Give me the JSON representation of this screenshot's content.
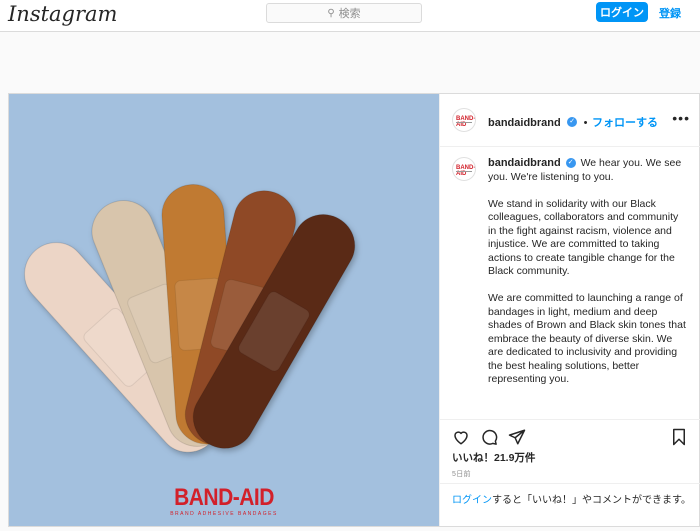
{
  "header": {
    "logo": "Instagram",
    "search_placeholder": "検索",
    "login_button": "ログイン",
    "signup_link": "登録"
  },
  "post": {
    "username": "bandaidbrand",
    "follow_label": "フォローする",
    "caption_lead": "We hear you. We see you. We're listening to you.",
    "caption_paragraphs": [
      "We stand in solidarity with our Black colleagues, collaborators and community in the fight against racism, violence and injustice. We are committed to taking actions to create tangible change for the Black community.",
      "We are committed to launching a range of bandages in light, medium and deep shades of Brown and Black skin tones that embrace the beauty of diverse skin. We are dedicated to inclusivity and providing the best healing solutions, better representing you."
    ],
    "likes": "いいね！21.9万件",
    "date": "5日前",
    "login_prompt_link": "ログイン",
    "login_prompt_rest": "すると「いいね！」やコメントができます。",
    "image_brand": "BAND-AID",
    "image_brand_sub": "BRAND ADHESIVE BANDAGES",
    "avatar_text": "BAND-AID",
    "colors": {
      "accent": "#0095f6",
      "image_bg": "#a3c0de",
      "brand_red": "#d2202a",
      "bandages": [
        "#ecd5c6",
        "#d8c5ac",
        "#c07a32",
        "#8f4a25",
        "#5a2a16"
      ]
    }
  }
}
